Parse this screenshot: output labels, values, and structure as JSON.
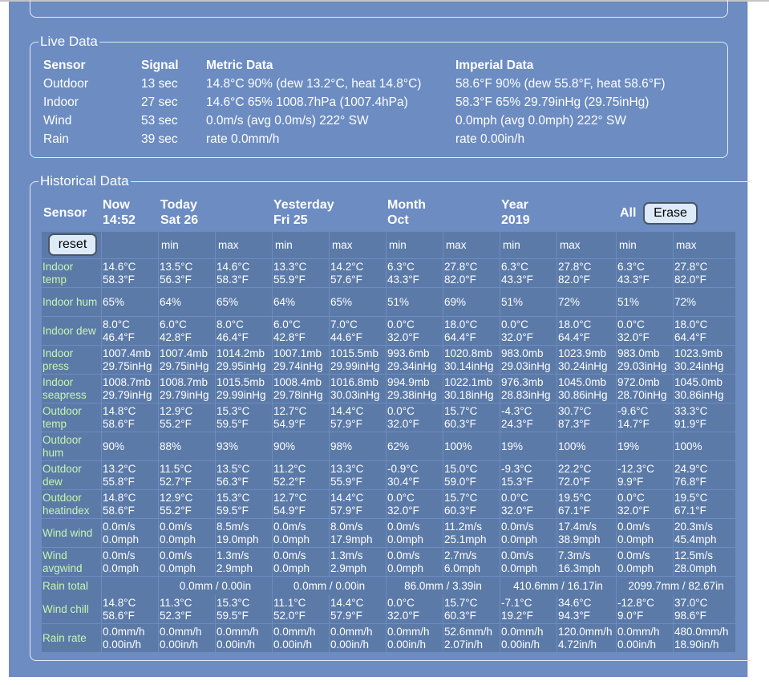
{
  "live": {
    "legend": "Live Data",
    "headers": [
      "Sensor",
      "Signal",
      "Metric Data",
      "Imperial Data"
    ],
    "rows": [
      {
        "sensor": "Outdoor",
        "signal": "13 sec",
        "metric": "14.8°C 90% (dew 13.2°C, heat 14.8°C)",
        "imperial": "58.6°F 90% (dew 55.8°F, heat 58.6°F)"
      },
      {
        "sensor": "Indoor",
        "signal": "27 sec",
        "metric": "14.6°C 65% 1008.7hPa (1007.4hPa)",
        "imperial": "58.3°F 65% 29.79inHg (29.75inHg)"
      },
      {
        "sensor": "Wind",
        "signal": "53 sec",
        "metric": "0.0m/s (avg 0.0m/s) 222° SW",
        "imperial": "0.0mph (avg 0.0mph) 222° SW"
      },
      {
        "sensor": "Rain",
        "signal": "39 sec",
        "metric": "rate 0.0mm/h",
        "imperial": "rate 0.00in/h"
      }
    ]
  },
  "historical": {
    "legend": "Historical Data",
    "sensor_header": "Sensor",
    "periods": [
      {
        "line1": "Now",
        "line2": "14:52"
      },
      {
        "line1": "Today",
        "line2": "Sat 26"
      },
      {
        "line1": "Yesterday",
        "line2": "Fri 25"
      },
      {
        "line1": "Month",
        "line2": "Oct"
      },
      {
        "line1": "Year",
        "line2": "2019"
      },
      {
        "line1": "All",
        "line2": ""
      }
    ],
    "erase_label": "Erase",
    "reset_label": "reset",
    "min_label": "min",
    "max_label": "max",
    "rows": [
      {
        "label": "Indoor temp",
        "now": "14.6°C 58.3°F",
        "cells": [
          "13.5°C 56.3°F",
          "14.6°C 58.3°F",
          "13.3°C 55.9°F",
          "14.2°C 57.6°F",
          "6.3°C 43.3°F",
          "27.8°C 82.0°F",
          "6.3°C 43.3°F",
          "27.8°C 82.0°F",
          "6.3°C 43.3°F",
          "27.8°C 82.0°F"
        ]
      },
      {
        "label": "Indoor hum",
        "now": "65%",
        "cells": [
          "64%",
          "65%",
          "64%",
          "65%",
          "51%",
          "69%",
          "51%",
          "72%",
          "51%",
          "72%"
        ]
      },
      {
        "label": "Indoor dew",
        "now": "8.0°C 46.4°F",
        "cells": [
          "6.0°C 42.8°F",
          "8.0°C 46.4°F",
          "6.0°C 42.8°F",
          "7.0°C 44.6°F",
          "0.0°C 32.0°F",
          "18.0°C 64.4°F",
          "0.0°C 32.0°F",
          "18.0°C 64.4°F",
          "0.0°C 32.0°F",
          "18.0°C 64.4°F"
        ]
      },
      {
        "label": "Indoor press",
        "now": "1007.4mb 29.75inHg",
        "cells": [
          "1007.4mb 29.75inHg",
          "1014.2mb 29.95inHg",
          "1007.1mb 29.74inHg",
          "1015.5mb 29.99inHg",
          "993.6mb 29.34inHg",
          "1020.8mb 30.14inHg",
          "983.0mb 29.03inHg",
          "1023.9mb 30.24inHg",
          "983.0mb 29.03inHg",
          "1023.9mb 30.24inHg"
        ]
      },
      {
        "label": "Indoor seapress",
        "now": "1008.7mb 29.79inHg",
        "cells": [
          "1008.7mb 29.79inHg",
          "1015.5mb 29.99inHg",
          "1008.4mb 29.78inHg",
          "1016.8mb 30.03inHg",
          "994.9mb 29.38inHg",
          "1022.1mb 30.18inHg",
          "976.3mb 28.83inHg",
          "1045.0mb 30.86inHg",
          "972.0mb 28.70inHg",
          "1045.0mb 30.86inHg"
        ]
      },
      {
        "label": "Outdoor temp",
        "now": "14.8°C 58.6°F",
        "cells": [
          "12.9°C 55.2°F",
          "15.3°C 59.5°F",
          "12.7°C 54.9°F",
          "14.4°C 57.9°F",
          "0.0°C 32.0°F",
          "15.7°C 60.3°F",
          "-4.3°C 24.3°F",
          "30.7°C 87.3°F",
          "-9.6°C 14.7°F",
          "33.3°C 91.9°F"
        ]
      },
      {
        "label": "Outdoor hum",
        "now": "90%",
        "cells": [
          "88%",
          "93%",
          "90%",
          "98%",
          "62%",
          "100%",
          "19%",
          "100%",
          "19%",
          "100%"
        ]
      },
      {
        "label": "Outdoor dew",
        "now": "13.2°C 55.8°F",
        "cells": [
          "11.5°C 52.7°F",
          "13.5°C 56.3°F",
          "11.2°C 52.2°F",
          "13.3°C 55.9°F",
          "-0.9°C 30.4°F",
          "15.0°C 59.0°F",
          "-9.3°C 15.3°F",
          "22.2°C 72.0°F",
          "-12.3°C 9.9°F",
          "24.9°C 76.8°F"
        ]
      },
      {
        "label": "Outdoor heatindex",
        "now": "14.8°C 58.6°F",
        "cells": [
          "12.9°C 55.2°F",
          "15.3°C 59.5°F",
          "12.7°C 54.9°F",
          "14.4°C 57.9°F",
          "0.0°C 32.0°F",
          "15.7°C 60.3°F",
          "0.0°C 32.0°F",
          "19.5°C 67.1°F",
          "0.0°C 32.0°F",
          "19.5°C 67.1°F"
        ]
      },
      {
        "label": "Wind wind",
        "now": "0.0m/s 0.0mph",
        "cells": [
          "0.0m/s 0.0mph",
          "8.5m/s 19.0mph",
          "0.0m/s 0.0mph",
          "8.0m/s 17.9mph",
          "0.0m/s 0.0mph",
          "11.2m/s 25.1mph",
          "0.0m/s 0.0mph",
          "17.4m/s 38.9mph",
          "0.0m/s 0.0mph",
          "20.3m/s 45.4mph"
        ]
      },
      {
        "label": "Wind avgwind",
        "now": "0.0m/s 0.0mph",
        "cells": [
          "0.0m/s 0.0mph",
          "1.3m/s 2.9mph",
          "0.0m/s 0.0mph",
          "1.3m/s 2.9mph",
          "0.0m/s 0.0mph",
          "2.7m/s 6.0mph",
          "0.0m/s 0.0mph",
          "7.3m/s 16.3mph",
          "0.0m/s 0.0mph",
          "12.5m/s 28.0mph"
        ]
      },
      {
        "label": "Rain total",
        "now": "",
        "spans": [
          "0.0mm / 0.00in",
          "0.0mm / 0.00in",
          "86.0mm / 3.39in",
          "410.6mm / 16.17in",
          "2099.7mm / 82.67in"
        ]
      },
      {
        "label": "Wind chill",
        "now": "14.8°C 58.6°F",
        "cells": [
          "11.3°C 52.3°F",
          "15.3°C 59.5°F",
          "11.1°C 52.0°F",
          "14.4°C 57.9°F",
          "0.0°C 32.0°F",
          "15.7°C 60.3°F",
          "-7.1°C 19.2°F",
          "34.6°C 94.3°F",
          "-12.8°C 9.0°F",
          "37.0°C 98.6°F"
        ]
      },
      {
        "label": "Rain rate",
        "now": "0.0mm/h 0.00in/h",
        "cells": [
          "0.0mm/h 0.00in/h",
          "0.0mm/h 0.00in/h",
          "0.0mm/h 0.00in/h",
          "0.0mm/h 0.00in/h",
          "0.0mm/h 0.00in/h",
          "52.6mm/h 2.07in/h",
          "0.0mm/h 0.00in/h",
          "120.0mm/h 4.72in/h",
          "0.0mm/h 0.00in/h",
          "480.0mm/h 18.90in/h"
        ]
      }
    ]
  }
}
